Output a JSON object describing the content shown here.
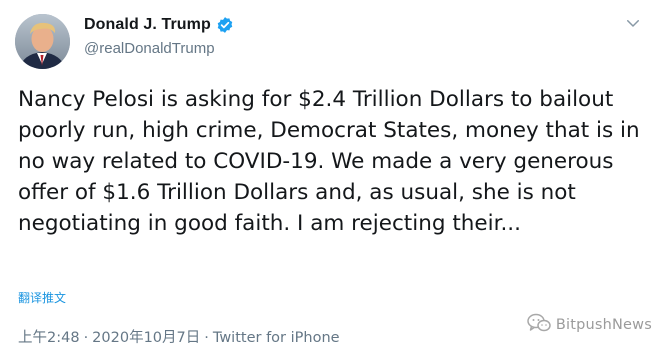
{
  "author": {
    "display_name": "Donald J. Trump",
    "handle": "@realDonaldTrump",
    "verified": true
  },
  "tweet": {
    "text": "Nancy Pelosi is asking for $2.4 Trillion Dollars to bailout poorly run, high crime, Democrat States, money that is in no way related to COVID-19. We made a very generous offer of $1.6 Trillion Dollars and, as usual, she is not negotiating in good faith. I am rejecting their...",
    "translate_label": "翻译推文"
  },
  "meta": {
    "time": "上午2:48",
    "date": "2020年10月7日",
    "source": "Twitter for iPhone",
    "separator": "·"
  },
  "watermark": {
    "text": "BitpushNews"
  },
  "colors": {
    "verified_badge": "#1da1f2",
    "link": "#1b95e0",
    "secondary_text": "#657786"
  },
  "icons": {
    "verified": "verified-badge-icon",
    "menu": "chevron-down-icon",
    "watermark_logo": "wechat-icon"
  }
}
